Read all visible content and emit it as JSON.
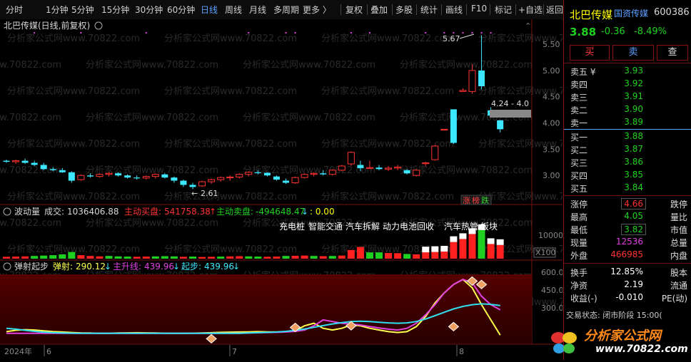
{
  "toolbar": {
    "periods": [
      "分时",
      "1分钟",
      "5分钟",
      "15分钟",
      "30分钟",
      "60分钟",
      "日线",
      "周线",
      "月线",
      "多周期",
      "更多 〉"
    ],
    "tools": [
      "复权",
      "叠加",
      "多股",
      "统计",
      "画线",
      "F10",
      "标记",
      "+自选",
      "返回"
    ]
  },
  "main": {
    "title": "北巴传媒(日线,前复权)",
    "watermark": "分析家公式网www.70822.com",
    "annotations": {
      "high": "5.67",
      "low": "2.61",
      "range": "4.24 - 4.0"
    },
    "y_labels": [
      "5.50",
      "5.00",
      "4.50",
      "4.00",
      "3.50",
      "3.00"
    ],
    "badge_up": "涨",
    "badge_rank": "榜",
    "badge_down": "跌"
  },
  "vol": {
    "name": "波动量",
    "turnover_label": "成交:",
    "turnover_value": "1036406.88",
    "buy_label": "主动买盘:",
    "buy_value": "541758.38",
    "sell_label": "主动卖盘:",
    "sell_value": "-494648.47",
    "extra": ": 0.00",
    "tags": [
      "充电桩",
      "智能交通",
      "汽车拆解",
      "动力电池回收",
      "汽车热管",
      "板块"
    ],
    "y_label": "10000",
    "unit": "X100"
  },
  "ind": {
    "name": "弹射起步",
    "tanshe_label": "弹射:",
    "tanshe_value": "290.12",
    "zhusheng_label": "主升线:",
    "zhusheng_value": "439.96",
    "qibu_label": "起步:",
    "qibu_value": "439.96",
    "y_labels": [
      "600.00",
      "450.00",
      "300.00"
    ]
  },
  "xaxis": {
    "year": "2024年",
    "labels": [
      "6",
      "7",
      "8"
    ]
  },
  "quote": {
    "name": "北巴传媒",
    "concept": "国资传媒",
    "code": "600386",
    "price": "3.88",
    "change": "-0.36",
    "pct": "-8.49%",
    "buy_btn": "买",
    "sell_btn": "卖",
    "query_btn": "查",
    "asks": [
      {
        "label": "卖五 ¥",
        "price": "3.93"
      },
      {
        "label": "卖四",
        "price": "3.92"
      },
      {
        "label": "卖三",
        "price": "3.91"
      },
      {
        "label": "卖二",
        "price": "3.90"
      },
      {
        "label": "卖一",
        "price": "3.89"
      }
    ],
    "bids": [
      {
        "label": "买一",
        "price": "3.88"
      },
      {
        "label": "买二",
        "price": "3.87"
      },
      {
        "label": "买三",
        "price": "3.86"
      },
      {
        "label": "买四",
        "price": "3.85"
      },
      {
        "label": "买五",
        "price": "3.84"
      }
    ],
    "stats": [
      {
        "label": "涨停",
        "value": "4.66",
        "right": "跌停"
      },
      {
        "label": "最高",
        "value": "4.05",
        "right": "量比"
      },
      {
        "label": "最低",
        "value": "3.82",
        "right": "市值"
      },
      {
        "label": "现量",
        "value": "12536",
        "right": "总量"
      },
      {
        "label": "外盘",
        "value": "466985",
        "right": "内盘"
      }
    ],
    "stats2": [
      {
        "label": "换手",
        "value": "12.85%",
        "right": "股本"
      },
      {
        "label": "净资",
        "value": "2.19",
        "right": "流通"
      },
      {
        "label": "收益(-)",
        "value": "-0.010",
        "right": "PE(动)"
      }
    ],
    "status": "交易状态: 闭市阶段 15:00(",
    "logo_text": "分析家公式网",
    "logo_url": "www.70822.com"
  },
  "chart_data": {
    "type": "candlestick",
    "title": "北巴传媒(日线,前复权)",
    "ylim": [
      2.5,
      5.8
    ],
    "candles": [
      [
        3.28,
        3.3,
        3.24,
        3.26
      ],
      [
        3.26,
        3.3,
        3.22,
        3.28
      ],
      [
        3.28,
        3.32,
        3.22,
        3.24
      ],
      [
        3.24,
        3.28,
        3.18,
        3.2
      ],
      [
        3.2,
        3.24,
        3.1,
        3.12
      ],
      [
        3.12,
        3.16,
        3.08,
        3.1
      ],
      [
        3.1,
        3.14,
        3.05,
        3.06
      ],
      [
        3.06,
        3.08,
        2.86,
        2.9
      ],
      [
        2.92,
        3.02,
        2.9,
        3.0
      ],
      [
        3.0,
        3.04,
        2.96,
        2.98
      ],
      [
        2.98,
        3.04,
        2.96,
        3.02
      ],
      [
        3.02,
        3.06,
        2.98,
        3.04
      ],
      [
        3.04,
        3.06,
        2.98,
        3.0
      ],
      [
        3.0,
        3.02,
        2.94,
        2.96
      ],
      [
        2.96,
        3.0,
        2.92,
        2.95
      ],
      [
        2.95,
        3.0,
        2.92,
        2.98
      ],
      [
        2.98,
        3.04,
        2.94,
        3.02
      ],
      [
        3.02,
        3.04,
        2.94,
        2.96
      ],
      [
        2.96,
        2.98,
        2.86,
        2.9
      ],
      [
        2.9,
        2.92,
        2.78,
        2.82
      ],
      [
        2.82,
        2.86,
        2.74,
        2.78
      ],
      [
        2.8,
        2.9,
        2.78,
        2.88
      ],
      [
        2.88,
        2.94,
        2.84,
        2.92
      ],
      [
        2.92,
        2.98,
        2.88,
        2.96
      ],
      [
        2.96,
        3.0,
        2.9,
        2.97
      ],
      [
        2.97,
        3.04,
        2.94,
        3.02
      ],
      [
        3.02,
        3.08,
        2.98,
        3.06
      ],
      [
        3.06,
        3.1,
        3.02,
        3.05
      ],
      [
        3.05,
        3.06,
        2.98,
        3.0
      ],
      [
        2.98,
        3.0,
        2.9,
        2.92
      ],
      [
        2.9,
        2.94,
        2.84,
        2.86
      ],
      [
        2.86,
        2.98,
        2.84,
        2.96
      ],
      [
        2.96,
        3.04,
        2.94,
        3.02
      ],
      [
        3.02,
        3.06,
        2.98,
        3.04
      ],
      [
        3.04,
        3.1,
        3.0,
        3.02
      ],
      [
        3.02,
        3.12,
        3.0,
        3.1
      ],
      [
        3.1,
        3.2,
        3.08,
        3.18
      ],
      [
        3.22,
        3.46,
        3.18,
        3.44
      ],
      [
        3.2,
        3.28,
        3.08,
        3.14
      ],
      [
        3.14,
        3.28,
        3.12,
        3.15
      ],
      [
        3.15,
        3.2,
        3.1,
        3.12
      ],
      [
        3.12,
        3.18,
        3.08,
        3.14
      ],
      [
        3.14,
        3.2,
        3.1,
        3.16
      ],
      [
        3.1,
        3.12,
        3.02,
        3.04
      ],
      [
        3.0,
        3.12,
        2.98,
        3.1
      ],
      [
        3.24,
        3.26,
        3.18,
        3.24
      ],
      [
        3.3,
        3.58,
        3.28,
        3.56
      ],
      [
        3.88,
        3.88,
        3.88,
        3.88
      ],
      [
        4.26,
        4.26,
        3.6,
        3.62
      ],
      [
        4.6,
        4.66,
        4.6,
        4.62
      ],
      [
        4.6,
        5.12,
        4.56,
        5.0
      ],
      [
        5.0,
        5.67,
        4.64,
        4.7
      ],
      [
        4.24,
        4.3,
        4.12,
        4.14
      ],
      [
        4.05,
        4.05,
        3.82,
        3.88
      ]
    ],
    "volume": [
      [
        "r",
        6
      ],
      [
        "r",
        7
      ],
      [
        "r",
        8
      ],
      [
        "g",
        10
      ],
      [
        "g",
        12
      ],
      [
        "g",
        14
      ],
      [
        "g",
        18
      ],
      [
        "g",
        30
      ],
      [
        "r",
        14
      ],
      [
        "r",
        10
      ],
      [
        "r",
        8
      ],
      [
        "g",
        10
      ],
      [
        "g",
        8
      ],
      [
        "g",
        7
      ],
      [
        "r",
        6
      ],
      [
        "r",
        7
      ],
      [
        "g",
        8
      ],
      [
        "g",
        9
      ],
      [
        "g",
        8
      ],
      [
        "r",
        6
      ],
      [
        "g",
        7
      ],
      [
        "r",
        5
      ],
      [
        "r",
        6
      ],
      [
        "g",
        7
      ],
      [
        "r",
        8
      ],
      [
        "r",
        9
      ],
      [
        "g",
        8
      ],
      [
        "g",
        7
      ],
      [
        "r",
        6
      ],
      [
        "r",
        7
      ],
      [
        "g",
        10
      ],
      [
        "r",
        11
      ],
      [
        "r",
        12
      ],
      [
        "g",
        10
      ],
      [
        "r",
        9
      ],
      [
        "g",
        10
      ],
      [
        "r",
        12
      ],
      [
        "r",
        40
      ],
      [
        "r",
        55
      ],
      [
        "g",
        28
      ],
      [
        "g",
        28
      ],
      [
        "r",
        25
      ],
      [
        "r",
        24
      ],
      [
        "g",
        20
      ],
      [
        "r",
        18
      ],
      [
        "r",
        28
      ],
      [
        "r",
        30
      ],
      [
        "r",
        32
      ],
      [
        "r",
        80
      ],
      [
        "r",
        95
      ],
      [
        "r",
        120
      ],
      [
        "g",
        140
      ],
      [
        "r",
        70
      ],
      [
        "r",
        65
      ]
    ],
    "indicator": {
      "series": [
        {
          "name": "弹射",
          "color": "#ffff50",
          "values": [
            310,
            318,
            322,
            320,
            315,
            310,
            308,
            305,
            303,
            302,
            300,
            300,
            302,
            303,
            304,
            303,
            302,
            301,
            300,
            300,
            301,
            302,
            304,
            306,
            307,
            308,
            309,
            310,
            309,
            308,
            310,
            315,
            345,
            360,
            330,
            320,
            330,
            350,
            345,
            330,
            320,
            310,
            305,
            310,
            340,
            400,
            480,
            540,
            590,
            620,
            570,
            470,
            380,
            290
          ]
        },
        {
          "name": "主升线",
          "color": "#e040e0",
          "values": [
            300,
            300,
            300,
            300,
            300,
            300,
            300,
            300,
            300,
            300,
            300,
            300,
            300,
            300,
            300,
            300,
            300,
            300,
            300,
            300,
            300,
            300,
            300,
            300,
            300,
            300,
            302,
            304,
            305,
            306,
            308,
            312,
            320,
            345,
            380,
            370,
            360,
            355,
            350,
            340,
            332,
            325,
            320,
            330,
            360,
            410,
            470,
            540,
            590,
            620,
            600,
            520,
            470,
            440
          ]
        },
        {
          "name": "起步",
          "color": "#30e0f0",
          "values": [
            330,
            325,
            318,
            312,
            307,
            304,
            302,
            301,
            300,
            300,
            300,
            300,
            300,
            300,
            300,
            300,
            300,
            300,
            300,
            300,
            300,
            300,
            300,
            300,
            300,
            300,
            302,
            304,
            306,
            308,
            312,
            318,
            326,
            336,
            346,
            356,
            364,
            370,
            372,
            370,
            366,
            362,
            360,
            362,
            370,
            385,
            405,
            425,
            445,
            460,
            470,
            475,
            472,
            465
          ]
        }
      ]
    }
  }
}
